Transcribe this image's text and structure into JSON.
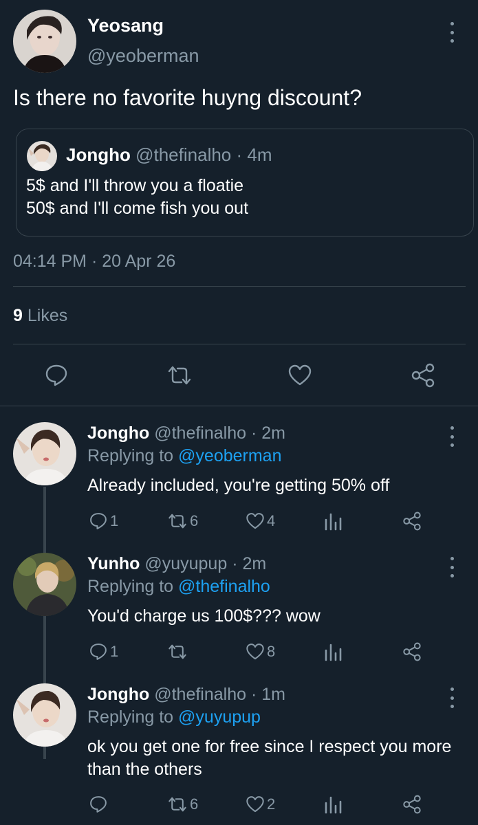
{
  "main_tweet": {
    "name": "Yeosang",
    "handle": "@yeoberman",
    "text": "Is there no favorite huyng discount?",
    "quote": {
      "name": "Jongho",
      "handle": "@thefinalho",
      "time": "· 4m",
      "line1": "5$ and I'll throw you a floatie",
      "line2": "50$ and I'll come fish you out"
    },
    "timestamp": "04:14 PM · 20 Apr 26",
    "likes_count": "9",
    "likes_label": "Likes",
    "actions": [
      "reply-icon",
      "retweet-icon",
      "heart-icon",
      "share-icon"
    ]
  },
  "replies": [
    {
      "name": "Jongho",
      "handle": "@thefinalho",
      "time": "· 2m",
      "replying_label": "Replying to",
      "replying_to": "@yeoberman",
      "text": "Already included, you're getting 50% off",
      "reply_count": "1",
      "retweet_count": "6",
      "like_count": "4"
    },
    {
      "name": "Yunho",
      "handle": "@yuyupup",
      "time": "· 2m",
      "replying_label": "Replying to",
      "replying_to": "@thefinalho",
      "text": "You'd charge us 100$??? wow",
      "reply_count": "1",
      "retweet_count": "",
      "like_count": "8"
    },
    {
      "name": "Jongho",
      "handle": "@thefinalho",
      "time": "· 1m",
      "replying_label": "Replying to",
      "replying_to": "@yuyupup",
      "text": "ok you get one for free since I respect you more than the others",
      "reply_count": "",
      "retweet_count": "6",
      "like_count": "2"
    }
  ],
  "colors": {
    "background": "#15202b",
    "muted": "#8899a6",
    "link": "#1da1f2",
    "divider": "#38444d"
  }
}
